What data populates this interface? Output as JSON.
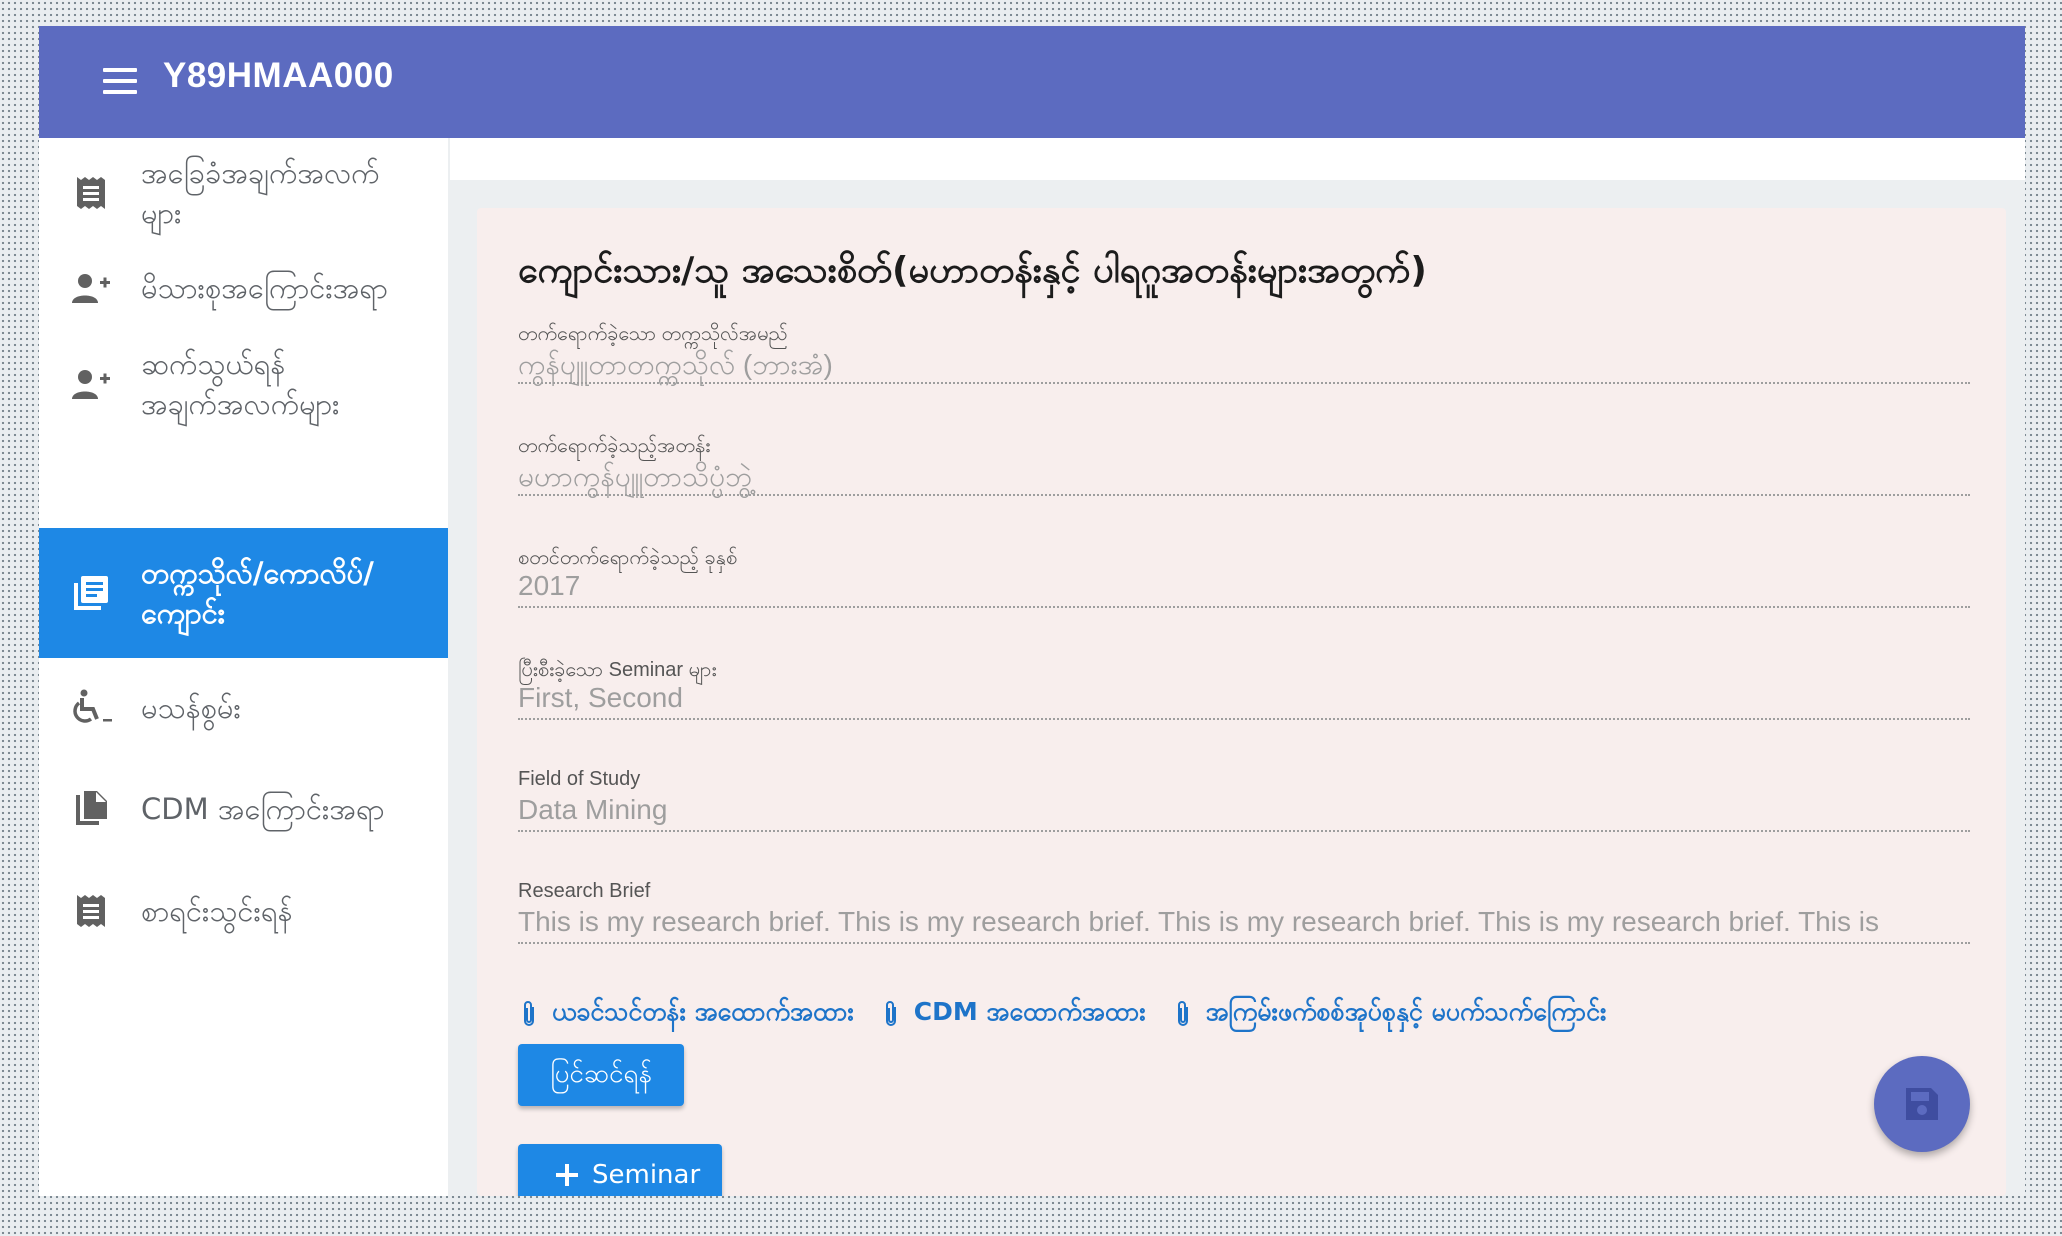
{
  "app": {
    "title": "Y89HMAA000"
  },
  "sidebar": {
    "items": [
      {
        "label": "အခြေခံအချက်အလက် များ",
        "icon": "receipt-icon",
        "active": false
      },
      {
        "label": "မိသားစုအကြောင်းအရာ",
        "icon": "person-add-icon",
        "active": false
      },
      {
        "label": "ဆက်သွယ်ရန် အချက်အလက်များ",
        "icon": "person-add-icon",
        "active": false
      },
      {
        "label": "တက္ကသိုလ်/ကောလိပ်/ ကျောင်း",
        "icon": "library-books-icon",
        "active": true
      },
      {
        "label": "မသန်စွမ်း",
        "icon": "accessible-icon",
        "active": false
      },
      {
        "label": "CDM အကြောင်းအရာ",
        "icon": "file-copy-icon",
        "active": false
      },
      {
        "label": "စာရင်းသွင်းရန်",
        "icon": "receipt-icon",
        "active": false
      }
    ]
  },
  "form": {
    "title": "ကျောင်းသား/သူ အသေးစိတ်(မဟာတန်းနှင့် ပါရဂူအတန်းများအတွက်)",
    "fields": [
      {
        "label": "တက်ရောက်ခဲ့သော တက္ကသိုလ်အမည်",
        "value": "ကွန်ပျူတာတက္ကသိုလ် (ဘားအံ)"
      },
      {
        "label": "တက်ရောက်ခဲ့သည့်အတန်း",
        "value": "မဟာကွန်ပျူတာသိပ္ပံဘွဲ့"
      },
      {
        "label": "စတင်တက်ရောက်ခဲ့သည့် ခုနှစ်",
        "value": "2017"
      },
      {
        "label": "ပြီးစီးခဲ့သော Seminar များ",
        "value": "First, Second"
      },
      {
        "label": "Field of Study",
        "value": "Data Mining"
      },
      {
        "label": "Research Brief",
        "value": "This is my research brief. This is my research brief. This is my research brief. This is my research brief. This is"
      }
    ],
    "attachments": [
      {
        "label": "ယခင်သင်တန်း အထောက်အထား",
        "icon": "paperclip-icon"
      },
      {
        "label": "CDM အထောက်အထား",
        "icon": "paperclip-icon"
      },
      {
        "label": "အကြမ်းဖက်စစ်အုပ်စုနှင့် မပက်သက်ကြောင်း",
        "icon": "paperclip-icon"
      }
    ],
    "edit_button": "ပြင်ဆင်ရန်",
    "seminar_button": "Seminar",
    "seminar_button_icon": "plus-icon"
  },
  "fab": {
    "icon": "save-icon"
  },
  "colors": {
    "appbar": "#5c6bc0",
    "active_nav": "#1e88e5",
    "button": "#1e88e5",
    "card_background": "#f8eeed",
    "link": "#1e74c9"
  }
}
